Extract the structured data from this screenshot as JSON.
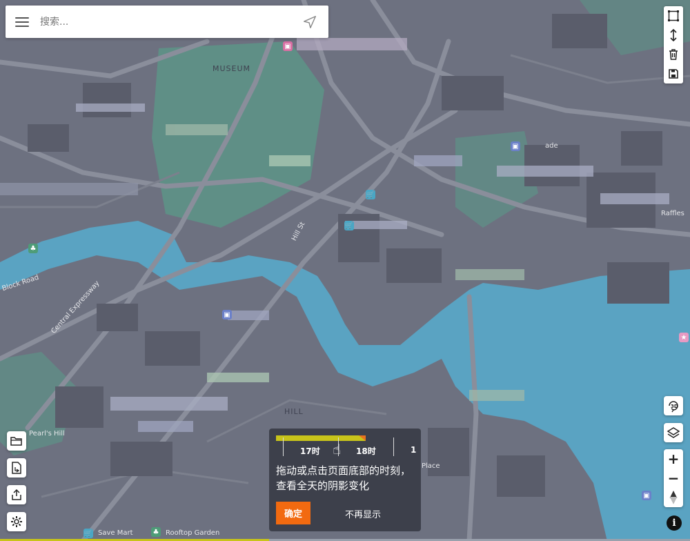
{
  "search": {
    "placeholder": "搜索..."
  },
  "map": {
    "labels": {
      "museum": "MUSEUM",
      "hill": "HILL",
      "block_road": "Block Road",
      "pearls_hill": "Pearl's Hill",
      "ade": "ade",
      "raffles": "Raffles",
      "place": "Place",
      "expressway": "Central Expressway",
      "save_mart": "Save Mart",
      "rooftop_garden": "Rooftop Garden",
      "hill_street": "Hill St"
    },
    "colors": {
      "land": "#6d7180",
      "water": "#5aa3c2",
      "park": "#5f8f86",
      "road": "#8a8e9b",
      "building": "#5a5d6b"
    }
  },
  "tools": {
    "right_top": [
      "polygon-icon",
      "measure-vertical-icon",
      "trash-icon",
      "save-icon"
    ],
    "right_mid": [
      "rotate-3d-icon",
      "layers-icon"
    ],
    "zoom": {
      "in": "+",
      "out": "−",
      "compass": "▲"
    },
    "info": "i",
    "left": [
      "folder-icon",
      "file-export-icon",
      "share-icon",
      "settings-icon"
    ]
  },
  "popup": {
    "hour_17": "17时",
    "hour_18": "18时",
    "hour_next": "1",
    "message": "拖动或点击页面底部的时刻，查看全天的阴影变化",
    "confirm": "确定",
    "dont_show": "不再显示"
  }
}
